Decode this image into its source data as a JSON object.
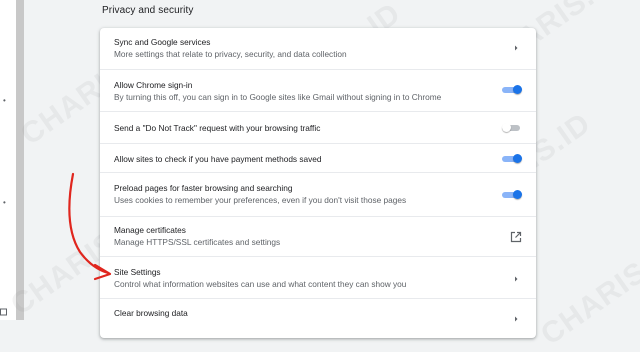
{
  "section_title": "Privacy and security",
  "rows": [
    {
      "title": "Sync and Google services",
      "subtitle": "More settings that relate to privacy, security, and data collection",
      "control": "chevron"
    },
    {
      "title": "Allow Chrome sign-in",
      "subtitle": "By turning this off, you can sign in to Google sites like Gmail without signing in to Chrome",
      "control": "toggle",
      "state": "on"
    },
    {
      "title": "Send a \"Do Not Track\" request with your browsing traffic",
      "subtitle": "",
      "control": "toggle",
      "state": "off"
    },
    {
      "title": "Allow sites to check if you have payment methods saved",
      "subtitle": "",
      "control": "toggle",
      "state": "on"
    },
    {
      "title": "Preload pages for faster browsing and searching",
      "subtitle": "Uses cookies to remember your preferences, even if you don't visit those pages",
      "control": "toggle",
      "state": "on"
    },
    {
      "title": "Manage certificates",
      "subtitle": "Manage HTTPS/SSL certificates and settings",
      "control": "external-link"
    },
    {
      "title": "Site Settings",
      "subtitle": "Control what information websites can use and what content they can show you",
      "control": "chevron"
    },
    {
      "title": "Clear browsing data",
      "subtitle": "",
      "control": "chevron"
    }
  ],
  "watermark": "CHARIS.ID",
  "colors": {
    "accent": "#1a73e8",
    "accent_track": "#8ab4f8",
    "annotation_arrow": "#e0261e",
    "page_bg": "#f1f3f4"
  },
  "icons": {
    "chevron": "chevron-right-icon",
    "external": "open-in-new-icon",
    "annotation": "red-arrow"
  }
}
